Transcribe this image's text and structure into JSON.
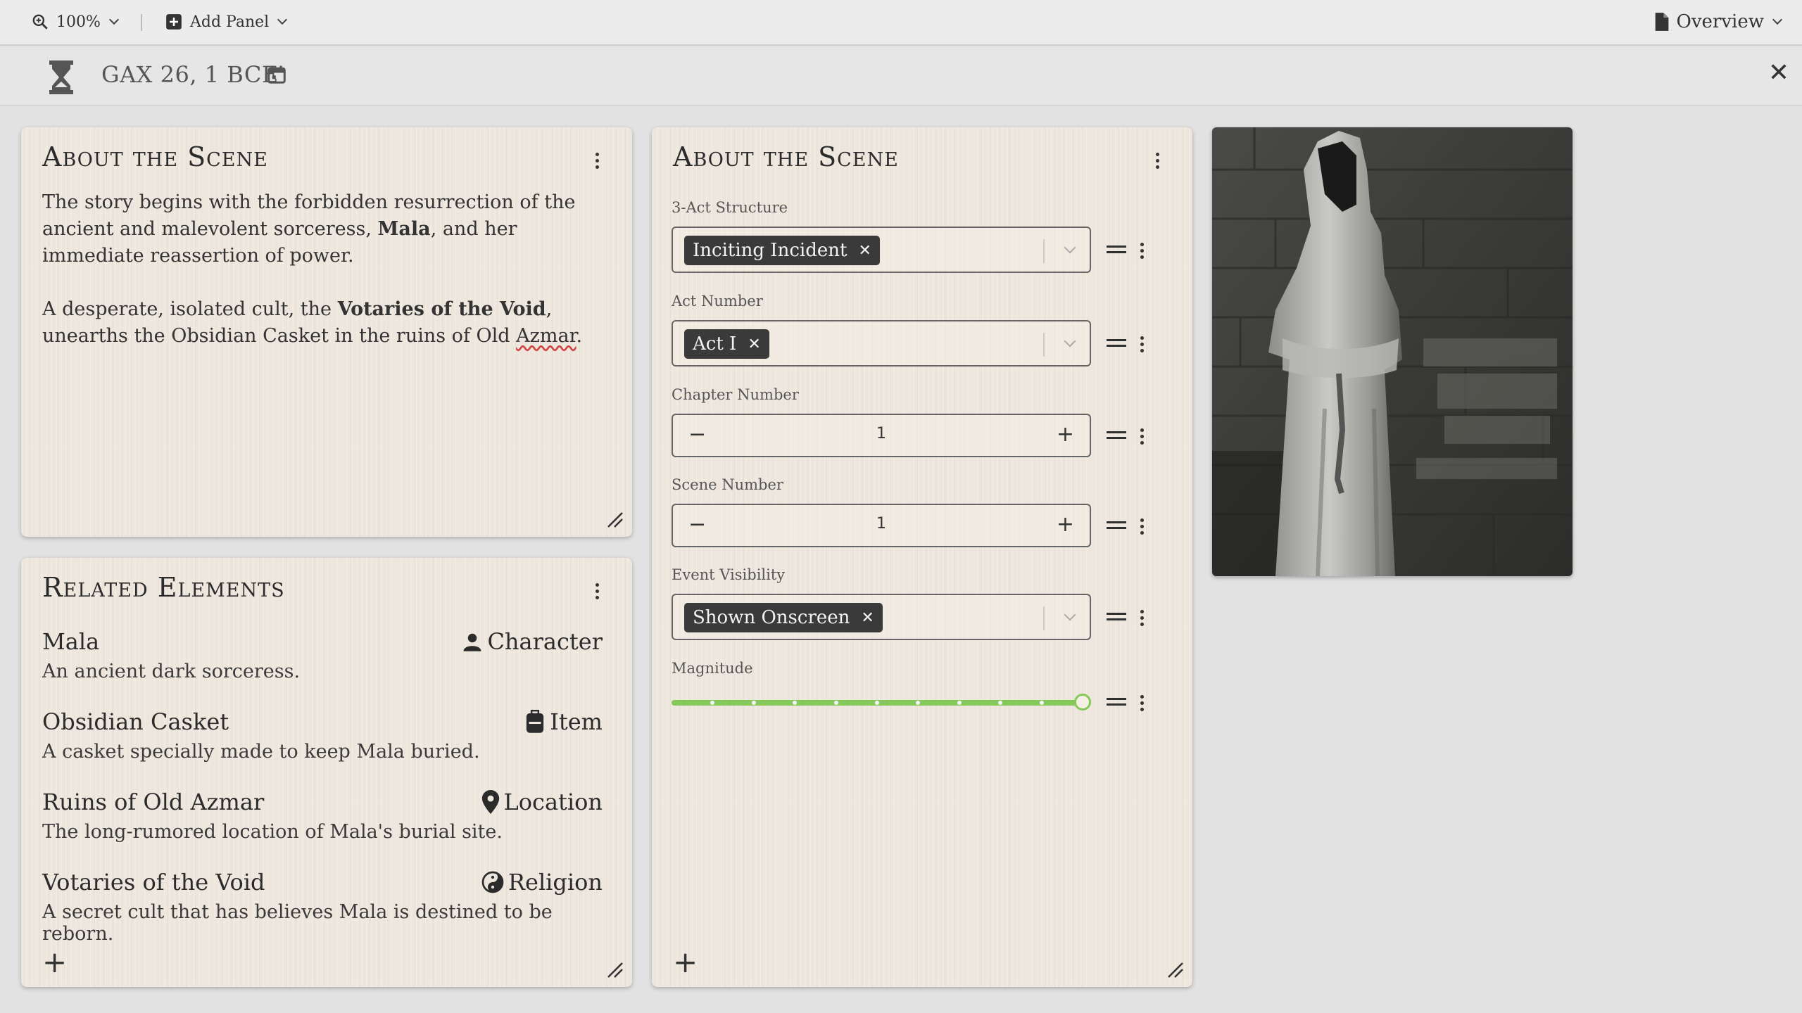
{
  "toolbar": {
    "zoom_label": "100%",
    "add_panel_label": "Add Panel",
    "overview_label": "Overview"
  },
  "datebar": {
    "date_text": "GAX 26, 1 BCE"
  },
  "about_panel": {
    "title": "About the Scene",
    "para1_pre": "The story begins with the forbidden resurrection of the ancient and malevolent sorceress, ",
    "para1_bold": "Mala",
    "para1_post": ", and her immediate reassertion of power.",
    "para2_pre": "A desperate, isolated cult, the ",
    "para2_bold": "Votaries of the Void",
    "para2_mid": ", unearths the Obsidian Casket in the ruins of Old ",
    "para2_misspelled": "Azmar",
    "para2_post": "."
  },
  "related_panel": {
    "title": "Related Elements",
    "items": [
      {
        "name": "Mala",
        "type": "Character",
        "icon": "person-icon",
        "desc": "An ancient dark sorceress."
      },
      {
        "name": "Obsidian Casket",
        "type": "Item",
        "icon": "backpack-icon",
        "desc": "A casket specially made to keep Mala buried."
      },
      {
        "name": "Ruins of Old Azmar",
        "type": "Location",
        "icon": "map-pin-icon",
        "desc": "The long-rumored location of Mala's burial site."
      },
      {
        "name": "Votaries of the Void",
        "type": "Religion",
        "icon": "yin-yang-icon",
        "desc": "A secret cult that has believes Mala is destined to be reborn."
      }
    ]
  },
  "fields_panel": {
    "title": "About the Scene",
    "act_structure": {
      "label": "3-Act Structure",
      "value": "Inciting Incident"
    },
    "act_number": {
      "label": "Act Number",
      "value": "Act I"
    },
    "chapter_number": {
      "label": "Chapter Number",
      "value": "1"
    },
    "scene_number": {
      "label": "Scene Number",
      "value": "1"
    },
    "event_visibility": {
      "label": "Event Visibility",
      "value": "Shown Onscreen"
    },
    "magnitude": {
      "label": "Magnitude",
      "value": 1.0,
      "accent": "#86c85a"
    }
  },
  "colors": {
    "panel_bg": "#ede6dc",
    "chip_bg": "#3a3a3a",
    "accent_green": "#86c85a"
  }
}
